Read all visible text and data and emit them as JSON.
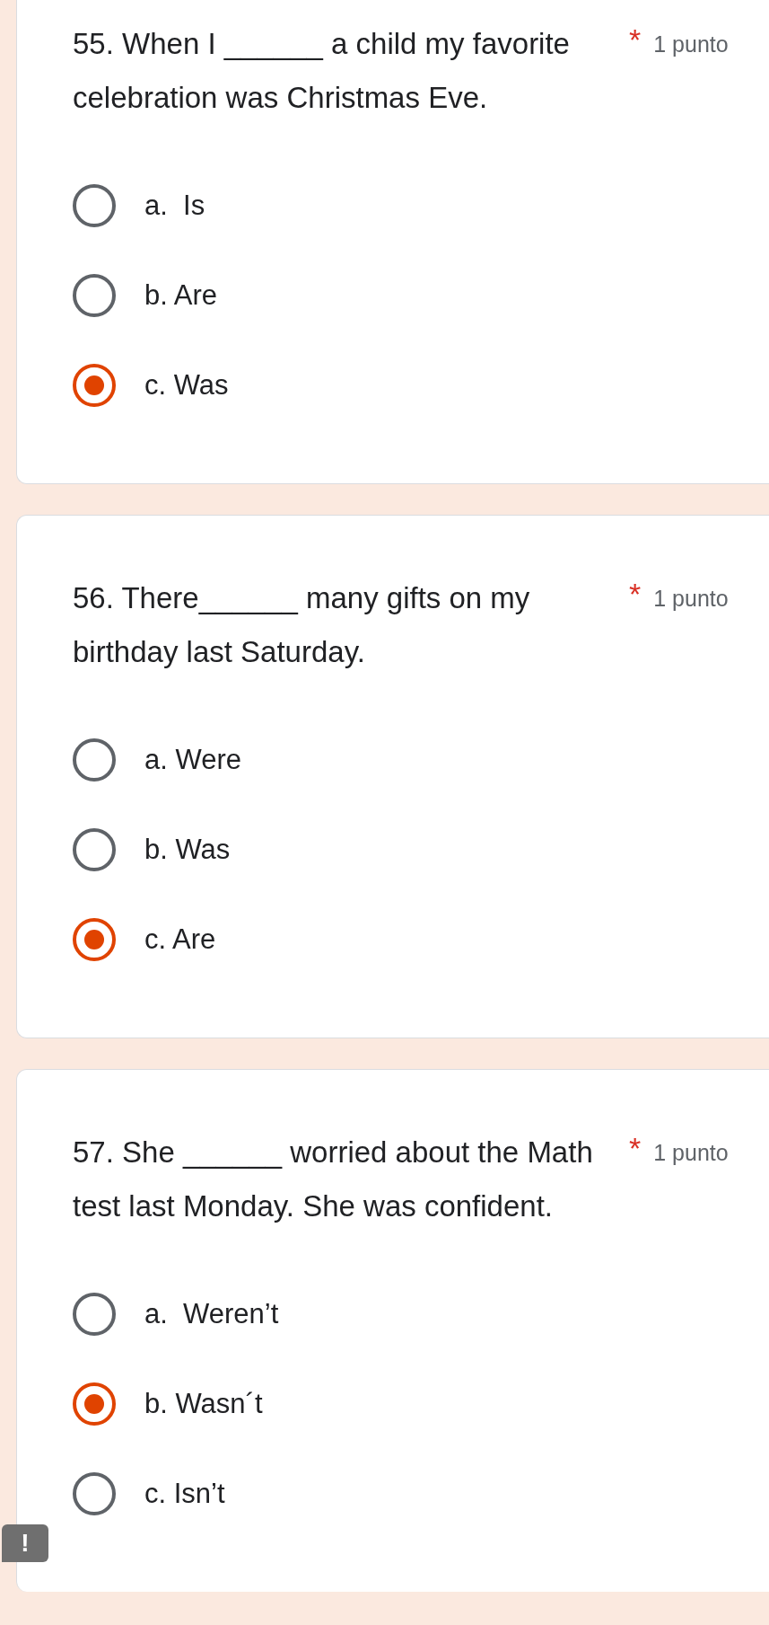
{
  "questions": [
    {
      "text": "55. When I ______ a child my favorite celebration was Christmas Eve.",
      "required_mark": "*",
      "points": "1 punto",
      "options": [
        {
          "label": "a.  Is",
          "selected": false
        },
        {
          "label": "b. Are",
          "selected": false
        },
        {
          "label": "c. Was",
          "selected": true
        }
      ]
    },
    {
      "text": "56. There______ many gifts on my birthday last Saturday.",
      "required_mark": "*",
      "points": "1 punto",
      "options": [
        {
          "label": "a. Were",
          "selected": false
        },
        {
          "label": "b. Was",
          "selected": false
        },
        {
          "label": "c. Are",
          "selected": true
        }
      ]
    },
    {
      "text": "57. She ______ worried about the Math test last Monday. She was confident.",
      "required_mark": "*",
      "points": "1 punto",
      "options": [
        {
          "label": "a.  Weren’t",
          "selected": false
        },
        {
          "label": "b. Wasn´t",
          "selected": true
        },
        {
          "label": "c. Isn’t",
          "selected": false
        }
      ]
    }
  ],
  "feedback_button": "!"
}
